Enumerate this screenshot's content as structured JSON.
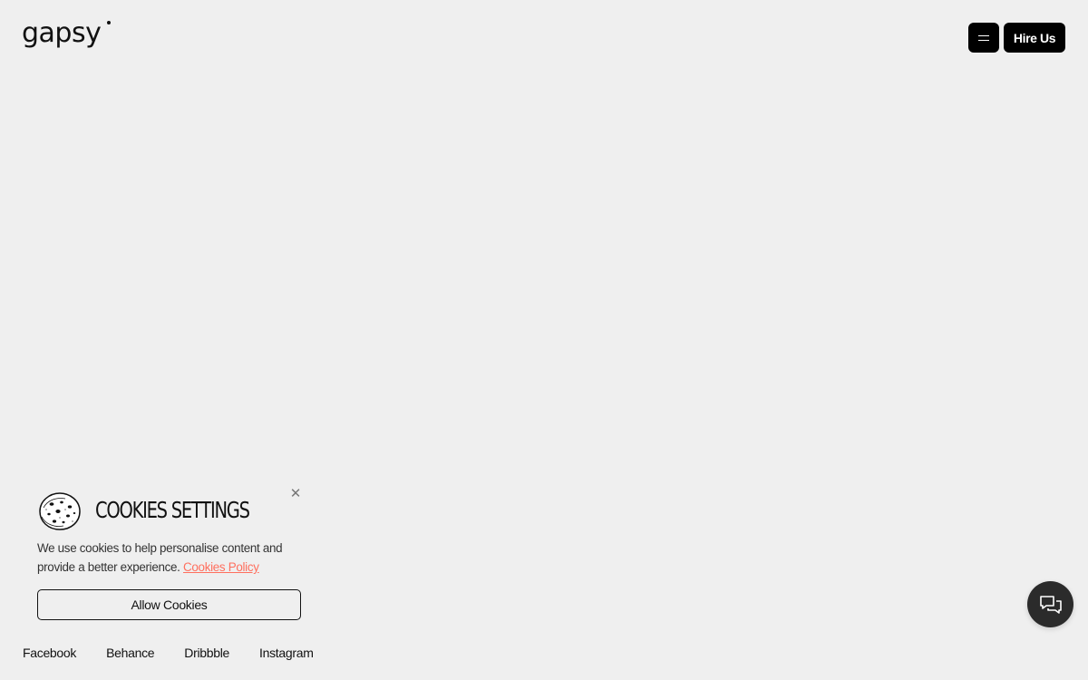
{
  "brand": {
    "logo_text": "gapsy"
  },
  "header": {
    "menu_icon": "hamburger-icon",
    "hire_label": "Hire Us"
  },
  "cookies": {
    "icon": "cookie-icon",
    "title": "COOKIES SETTINGS",
    "body": "We use cookies to help personalise content and provide a better experience.",
    "policy_link": "Cookies Policy",
    "allow_label": "Allow Cookies",
    "close_icon": "close-icon"
  },
  "social": {
    "links": [
      "Facebook",
      "Behance",
      "Dribbble",
      "Instagram"
    ]
  },
  "chat": {
    "icon": "chat-bubbles-icon"
  },
  "colors": {
    "background": "#efefef",
    "button": "#000000",
    "link_accent": "#ff6f5e",
    "chat_button": "#2b2b2b"
  }
}
